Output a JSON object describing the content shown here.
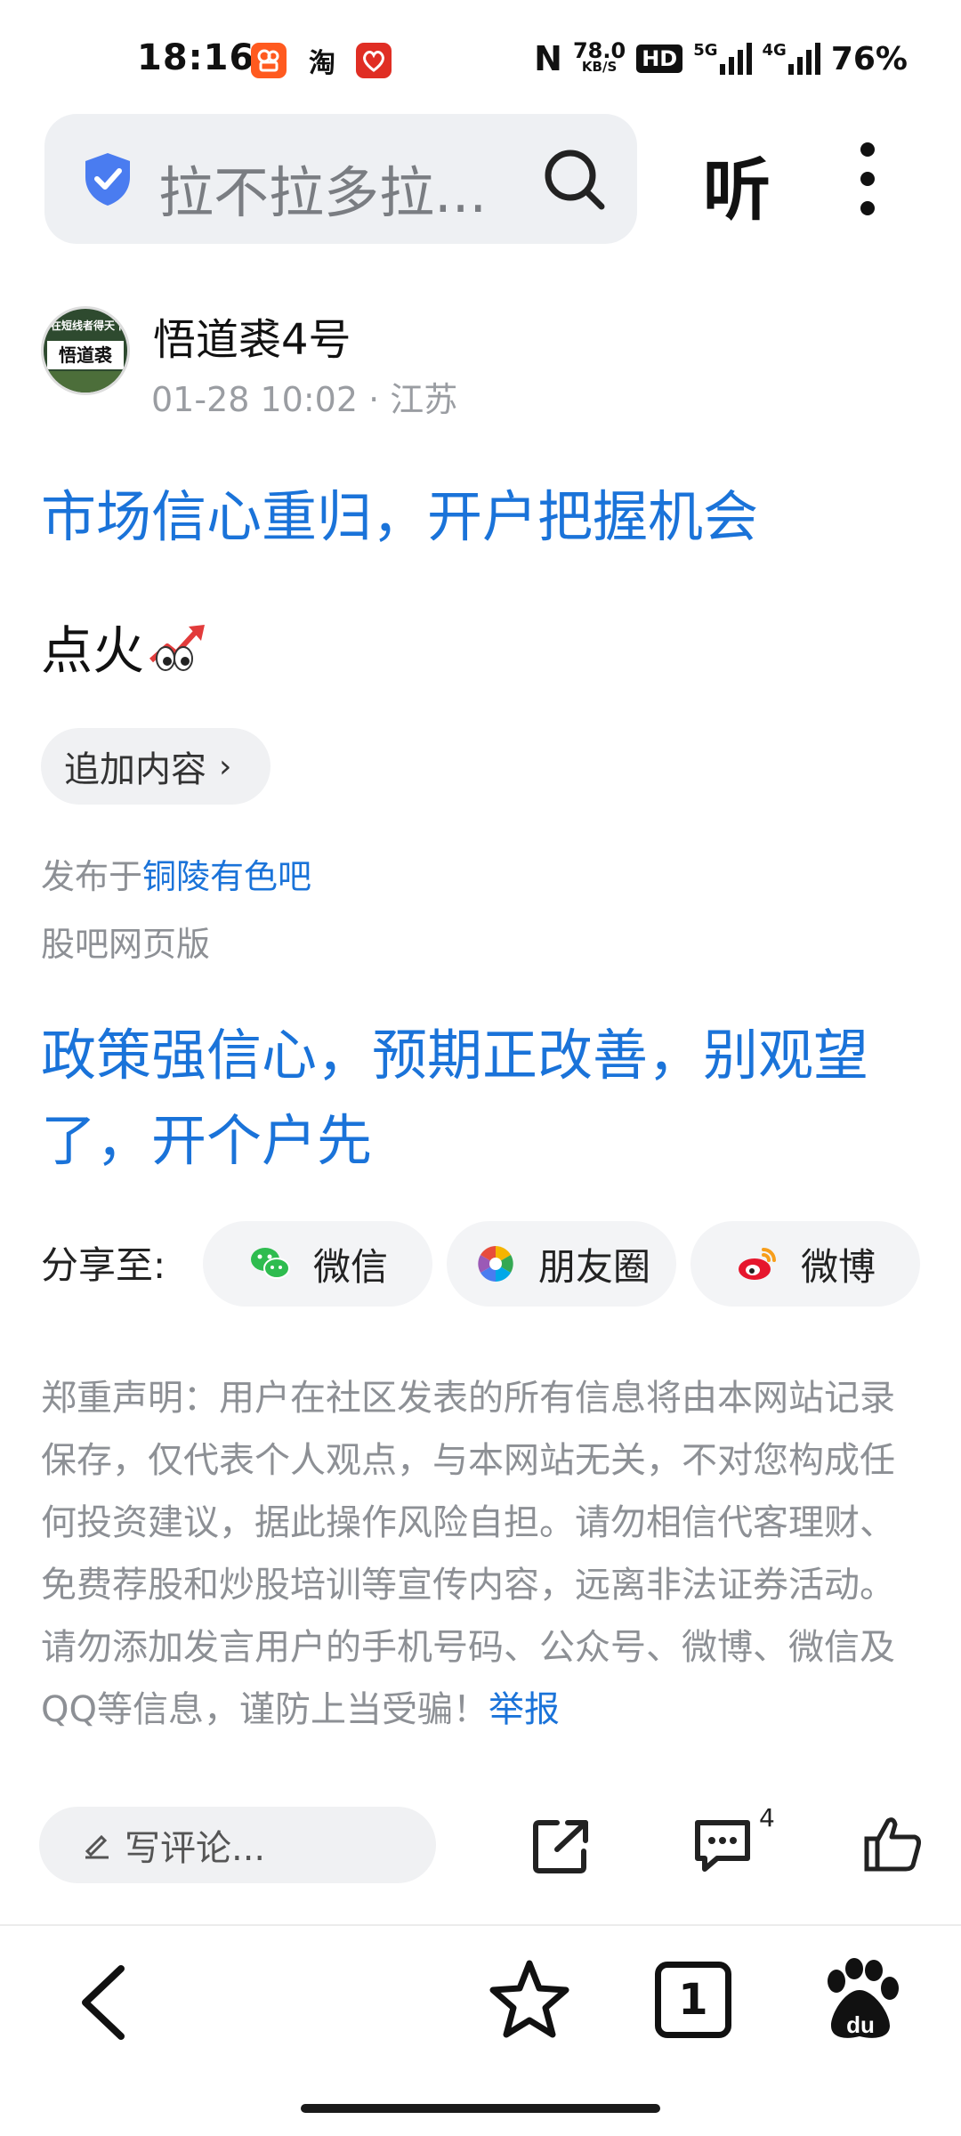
{
  "status_bar": {
    "time": "18:16",
    "app_icons": [
      "kuaishou-icon",
      "taobao-icon",
      "pinduoduo-icon"
    ],
    "taobao_label": "淘",
    "nfc_label": "N",
    "speed_value": "78.0",
    "speed_unit": "KB/S",
    "hd_label": "HD",
    "network_5g": "5G",
    "network_4g": "4G",
    "battery": "76%"
  },
  "search": {
    "query": "拉不拉多拉...",
    "listen_label": "听"
  },
  "author": {
    "avatar_text_top": "在短线者得天下",
    "avatar_text_main": "悟道裘",
    "name": "悟道裘4号",
    "meta": "01-28 10:02 · 江苏"
  },
  "post": {
    "title": "市场信心重归，开户把握机会",
    "body": "点火",
    "body_emojis": [
      "chart-up-icon",
      "eyes-icon"
    ],
    "append_label": "追加内容",
    "published_prefix": "发布于",
    "published_forum": "铜陵有色吧",
    "guba_label": "股吧网页版"
  },
  "ad": {
    "title": "政策强信心，预期正改善，别观望了，开个户先"
  },
  "share": {
    "label": "分享至:",
    "wechat": "微信",
    "moments": "朋友圈",
    "weibo": "微博"
  },
  "disclaimer": {
    "text": "郑重声明：用户在社区发表的所有信息将由本网站记录保存，仅代表个人观点，与本网站无关，不对您构成任何投资建议，据此操作风险自担。请勿相信代客理财、免费荐股和炒股培训等宣传内容，远离非法证券活动。请勿添加发言用户的手机号码、公众号、微博、微信及QQ等信息，谨防上当受骗！",
    "report_link": "举报"
  },
  "comment_bar": {
    "placeholder": "写评论...",
    "comment_count": "4"
  },
  "bottom_nav": {
    "tabs_count": "1"
  },
  "colors": {
    "link_blue": "#1a73d9",
    "muted_gray": "#8d9095",
    "pill_bg": "#f0f1f3"
  }
}
